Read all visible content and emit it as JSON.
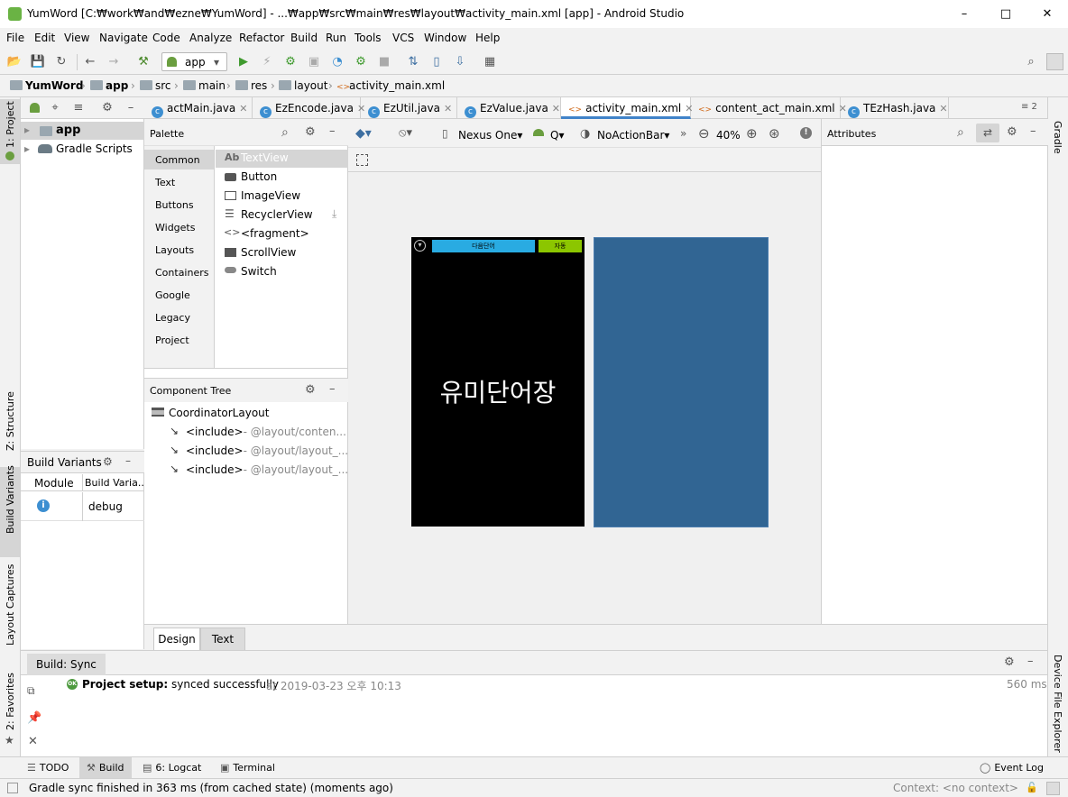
{
  "window": {
    "title": "YumWord [C:₩work₩and₩ezne₩YumWord] - ...₩app₩src₩main₩res₩layout₩activity_main.xml [app] - Android Studio",
    "minimize": "–",
    "maximize": "□",
    "close": "✕"
  },
  "menu": [
    "File",
    "Edit",
    "View",
    "Navigate",
    "Code",
    "Analyze",
    "Refactor",
    "Build",
    "Run",
    "Tools",
    "VCS",
    "Window",
    "Help"
  ],
  "toolbar": {
    "config_label": "app",
    "config_arrow": "▾"
  },
  "breadcrumb": [
    "YumWord",
    "app",
    "src",
    "main",
    "res",
    "layout",
    "activity_main.xml"
  ],
  "left_strip": {
    "project": "1: Project",
    "structure": "Z: Structure",
    "build_variants": "Build Variants",
    "layout_captures": "Layout Captures",
    "favorites": "2: Favorites"
  },
  "right_strip": {
    "gradle": "Gradle",
    "device_file_explorer": "Device File Explorer"
  },
  "project_tree": [
    {
      "label": "app",
      "arrow": "▸"
    },
    {
      "label": "Gradle Scripts",
      "arrow": "▸"
    }
  ],
  "build_variants": {
    "title": "Build Variants",
    "col_module": "Module",
    "col_variant": "Build Varia...",
    "row_variant": "debug",
    "info_icon": "i"
  },
  "editor_tabs": [
    "actMain.java",
    "EzEncode.java",
    "EzUtil.java",
    "EzValue.java",
    "activity_main.xml",
    "content_act_main.xml",
    "TEzHash.java"
  ],
  "editor_tabs_more": "≡ 2",
  "palette": {
    "title": "Palette",
    "categories": [
      "Common",
      "Text",
      "Buttons",
      "Widgets",
      "Layouts",
      "Containers",
      "Google",
      "Legacy",
      "Project"
    ],
    "items": [
      "TextView",
      "Button",
      "ImageView",
      "RecyclerView",
      "<fragment>",
      "ScrollView",
      "Switch"
    ],
    "textview_prefix": "Ab"
  },
  "component_tree": {
    "title": "Component Tree",
    "root": "CoordinatorLayout",
    "children": [
      {
        "tag": "<include>",
        "ref": "- @layout/conten..."
      },
      {
        "tag": "<include>",
        "ref": "- @layout/layout_..."
      },
      {
        "tag": "<include>",
        "ref": "- @layout/layout_..."
      }
    ]
  },
  "design_toolbar": {
    "device": "Nexus One",
    "api": "Q",
    "theme": "NoActionBar",
    "zoom": "40%",
    "more": "»"
  },
  "phone": {
    "btn_next": "다음단어",
    "btn_auto": "자동",
    "title": "유미단어장"
  },
  "attributes": {
    "title": "Attributes"
  },
  "bottom_editor_tabs": [
    "Design",
    "Text"
  ],
  "build_panel": {
    "tab": "Build: Sync",
    "ok_badge": "OK",
    "line_bold": "Project setup:",
    "line_text": "synced successfully",
    "timestamp": "at 2019-03-23 오후 10:13",
    "duration": "560 ms"
  },
  "tool_tabs": {
    "todo": "TODO",
    "build": "Build",
    "logcat": "6: Logcat",
    "terminal": "Terminal",
    "event_log": "Event Log"
  },
  "status": {
    "message": "Gradle sync finished in 363 ms (from cached state) (moments ago)",
    "context": "Context: <no context>"
  },
  "colors": {
    "phone_button_blue": "#29abe2",
    "phone_button_green": "#8cc600",
    "blueprint": "#316593",
    "android_green": "#6a9e3f"
  }
}
